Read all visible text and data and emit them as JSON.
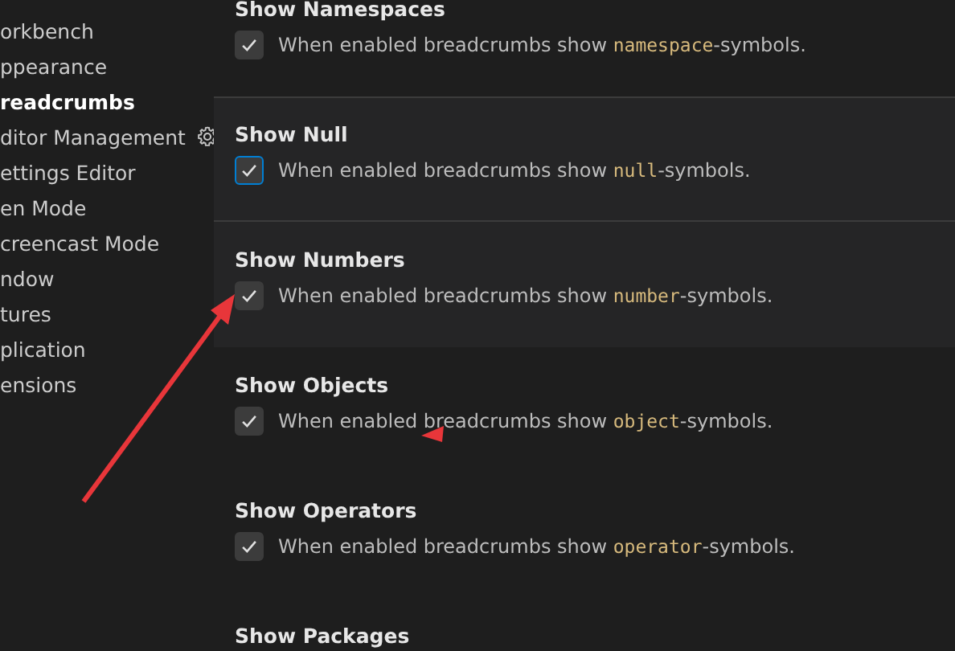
{
  "sidebar": {
    "items": [
      {
        "label": "orkbench",
        "selected": false,
        "gear": false
      },
      {
        "label": "ppearance",
        "selected": false,
        "gear": false
      },
      {
        "label": "readcrumbs",
        "selected": true,
        "gear": false
      },
      {
        "label": "ditor Management",
        "selected": false,
        "gear": true
      },
      {
        "label": "ettings Editor",
        "selected": false,
        "gear": false
      },
      {
        "label": "en Mode",
        "selected": false,
        "gear": false
      },
      {
        "label": "creencast Mode",
        "selected": false,
        "gear": false
      },
      {
        "label": "ndow",
        "selected": false,
        "gear": false
      },
      {
        "label": "tures",
        "selected": false,
        "gear": false
      },
      {
        "label": "plication",
        "selected": false,
        "gear": false
      },
      {
        "label": "ensions",
        "selected": false,
        "gear": false
      }
    ]
  },
  "settings": [
    {
      "title": "Show Namespaces",
      "text": "When enabled breadcrumbs show ",
      "code": "namespace",
      "suffix": "-symbols.",
      "checked": true,
      "focused": false,
      "hovered": false
    },
    {
      "title": "Show Null",
      "text": "When enabled breadcrumbs show ",
      "code": "null",
      "suffix": "-symbols.",
      "checked": true,
      "focused": true,
      "hovered": true
    },
    {
      "title": "Show Numbers",
      "text": "When enabled breadcrumbs show ",
      "code": "number",
      "suffix": "-symbols.",
      "checked": true,
      "focused": false,
      "hovered": true
    },
    {
      "title": "Show Objects",
      "text": "When enabled breadcrumbs show ",
      "code": "object",
      "suffix": "-symbols.",
      "checked": true,
      "focused": false,
      "hovered": false
    },
    {
      "title": "Show Operators",
      "text": "When enabled breadcrumbs show ",
      "code": "operator",
      "suffix": "-symbols.",
      "checked": true,
      "focused": false,
      "hovered": false
    },
    {
      "title": "Show Packages",
      "focused": false,
      "hovered": false
    }
  ]
}
